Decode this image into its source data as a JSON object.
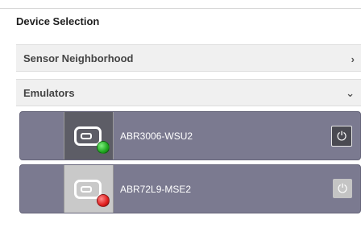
{
  "panel": {
    "title": "Device Selection"
  },
  "sections": {
    "sensor": {
      "label": "Sensor Neighborhood",
      "chevron": "›",
      "expanded": false
    },
    "emulators": {
      "label": "Emulators",
      "chevron": "⌄",
      "expanded": true
    }
  },
  "devices": [
    {
      "name": "ABR3006-WSU2",
      "status_color": "#2db52d",
      "power_icon": "⏻",
      "icon": "device-icon"
    },
    {
      "name": "ABR72L9-MSE2",
      "status_color": "#e01e1e",
      "power_icon": "⏻",
      "icon": "device-icon"
    }
  ]
}
